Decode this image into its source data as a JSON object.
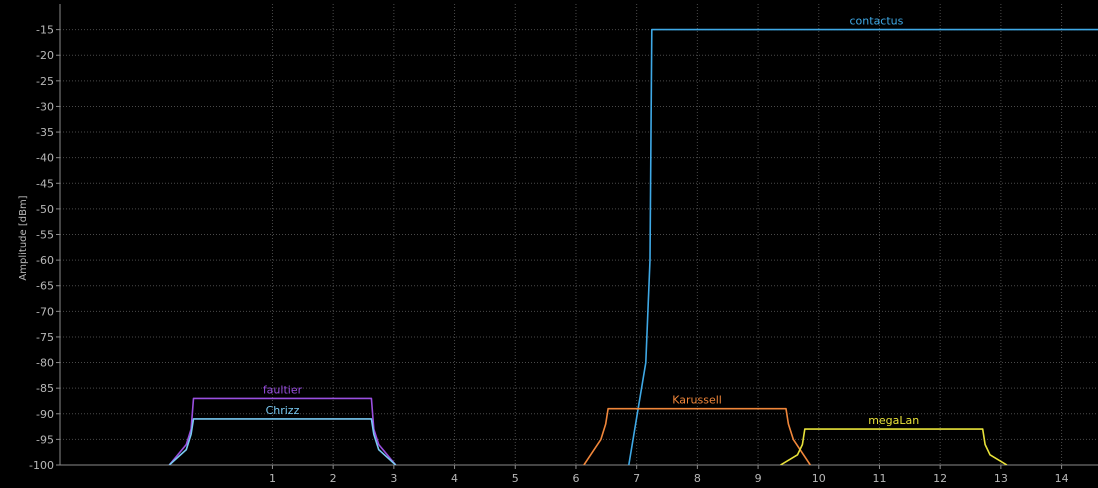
{
  "chart_data": {
    "type": "area",
    "title": "",
    "xlabel": "",
    "ylabel": "Amplitude [dBm]",
    "xlim": [
      -2.5,
      14.6
    ],
    "ylim": [
      -100,
      -10
    ],
    "x_ticks": [
      1,
      2,
      3,
      4,
      5,
      6,
      7,
      8,
      9,
      10,
      11,
      12,
      13,
      14
    ],
    "y_ticks": [
      -100,
      -95,
      -90,
      -85,
      -80,
      -75,
      -70,
      -65,
      -60,
      -55,
      -50,
      -45,
      -40,
      -35,
      -30,
      -25,
      -20,
      -15
    ],
    "grid": true,
    "colors": {
      "background": "#000000",
      "axis": "#8a8a8a",
      "grid": "#4a4a4a",
      "tick_label": "#b8b8b8"
    },
    "series": [
      {
        "name": "contactus",
        "color": "#3fa9e6",
        "points": [
          [
            6.87,
            -100
          ],
          [
            7.15,
            -80
          ],
          [
            7.22,
            -60
          ],
          [
            7.25,
            -15
          ],
          [
            14.65,
            -15
          ],
          [
            14.68,
            -60
          ],
          [
            14.75,
            -80
          ],
          [
            15.03,
            -100
          ]
        ]
      },
      {
        "name": "faultier",
        "color": "#9a4fe0",
        "points": [
          [
            -0.7,
            -100
          ],
          [
            -0.42,
            -96
          ],
          [
            -0.34,
            -93
          ],
          [
            -0.3,
            -87
          ],
          [
            2.63,
            -87
          ],
          [
            2.67,
            -93
          ],
          [
            2.75,
            -96
          ],
          [
            3.03,
            -100
          ]
        ]
      },
      {
        "name": "Chrizz",
        "color": "#79c9f2",
        "points": [
          [
            -0.7,
            -100
          ],
          [
            -0.42,
            -97
          ],
          [
            -0.34,
            -94
          ],
          [
            -0.3,
            -91
          ],
          [
            2.63,
            -91
          ],
          [
            2.67,
            -94
          ],
          [
            2.75,
            -97
          ],
          [
            3.03,
            -100
          ]
        ]
      },
      {
        "name": "Karussell",
        "color": "#f0863a",
        "points": [
          [
            6.13,
            -100
          ],
          [
            6.41,
            -95
          ],
          [
            6.49,
            -92
          ],
          [
            6.53,
            -89
          ],
          [
            9.46,
            -89
          ],
          [
            9.5,
            -92
          ],
          [
            9.58,
            -95
          ],
          [
            9.86,
            -100
          ]
        ]
      },
      {
        "name": "megaLan",
        "color": "#e8e23a",
        "points": [
          [
            9.37,
            -100
          ],
          [
            9.65,
            -98
          ],
          [
            9.73,
            -96
          ],
          [
            9.77,
            -93
          ],
          [
            12.7,
            -93
          ],
          [
            12.74,
            -96
          ],
          [
            12.82,
            -98
          ],
          [
            13.1,
            -100
          ]
        ]
      }
    ]
  }
}
